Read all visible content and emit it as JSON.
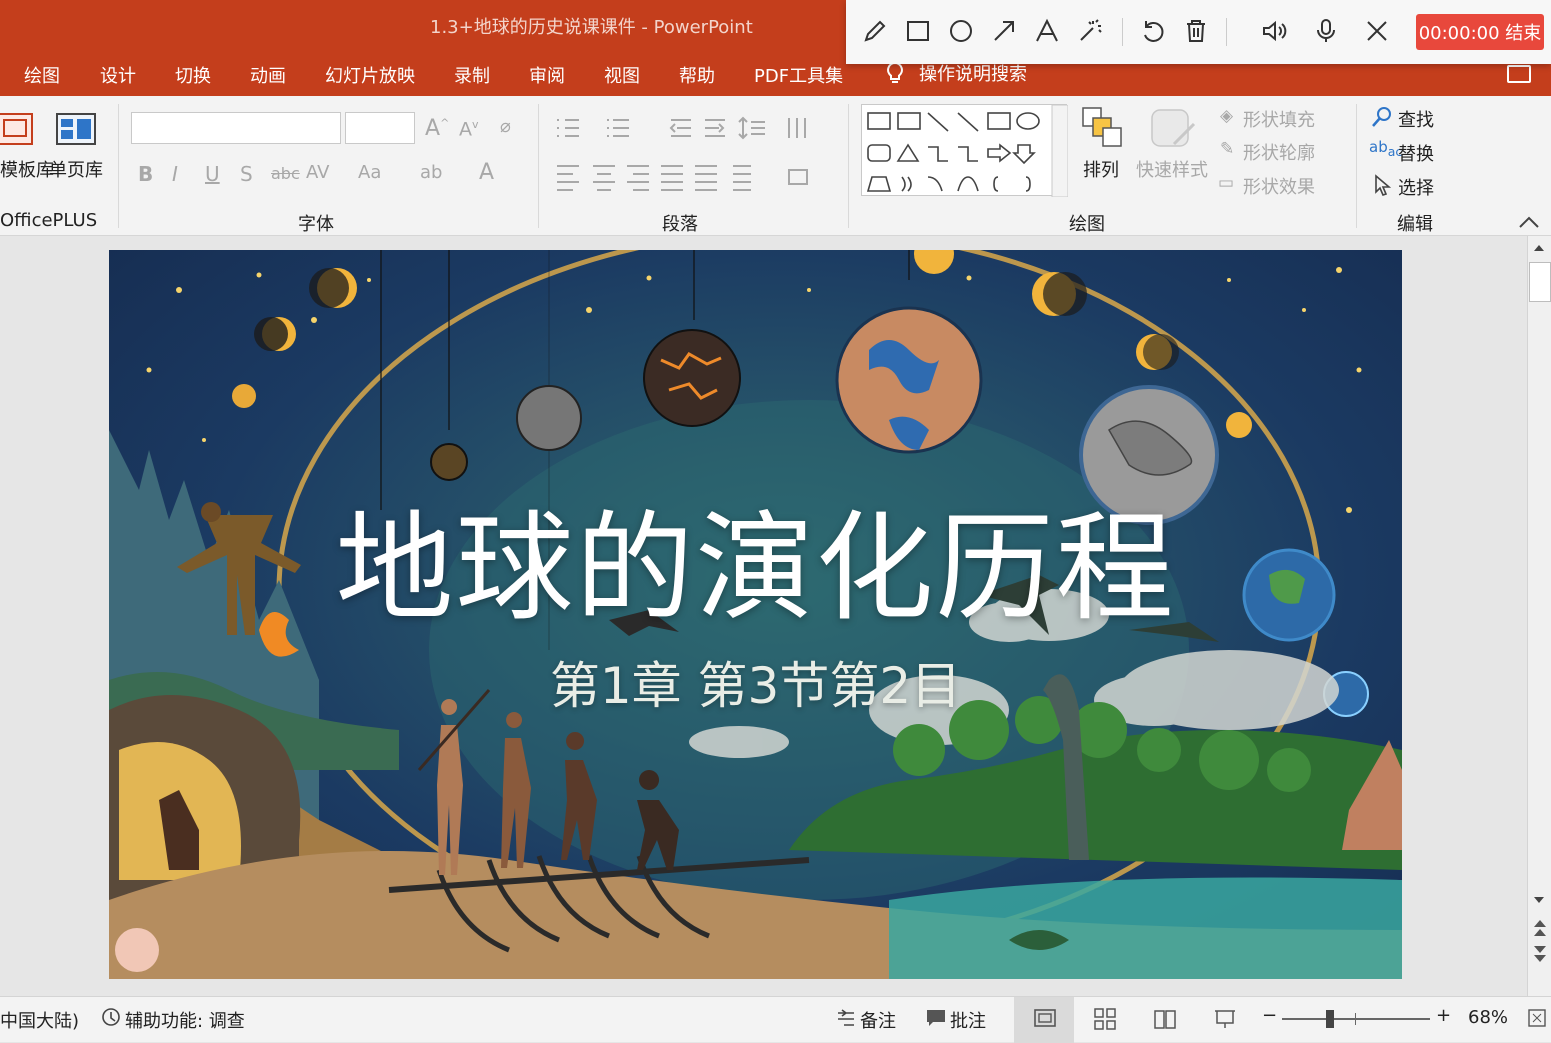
{
  "window": {
    "title": "1.3+地球的历史说课课件  -  PowerPoint"
  },
  "tabs": [
    "绘图",
    "设计",
    "切换",
    "动画",
    "幻灯片放映",
    "录制",
    "审阅",
    "视图",
    "帮助",
    "PDF工具集"
  ],
  "tell_me": "操作说明搜索",
  "draw_toolbar": {
    "tools": [
      "pencil-icon",
      "rectangle-icon",
      "circle-icon",
      "arrow-icon",
      "text-icon",
      "laser-pointer-icon",
      "undo-icon",
      "trash-icon",
      "speaker-icon",
      "microphone-icon",
      "close-icon"
    ],
    "recording": "00:00:00 结束"
  },
  "ribbon": {
    "officeplus": {
      "template_lib": "模板库",
      "single_page_lib": "单页库",
      "group": "OfficePLUS"
    },
    "font": {
      "group": "字体",
      "buttons": [
        "B",
        "I",
        "U",
        "S",
        "abc",
        "AV",
        "Aa",
        "A"
      ]
    },
    "paragraph": {
      "group": "段落"
    },
    "drawing": {
      "group": "绘图",
      "arrange": "排列",
      "quick_styles": "快速样式",
      "shape_fill": "形状填充",
      "shape_outline": "形状轮廓",
      "shape_effects": "形状效果"
    },
    "editing": {
      "group": "编辑",
      "find": "查找",
      "replace": "替换",
      "select": "选择"
    }
  },
  "slide": {
    "title": "地球的演化历程",
    "subtitle": "第1章 第3节第2目"
  },
  "status": {
    "language": "中国大陆)",
    "accessibility": "辅助功能: 调查",
    "notes": "备注",
    "comments": "批注",
    "zoom": "68%",
    "zoom_level": 0.68
  },
  "colors": {
    "accent": "#c43e1c",
    "record": "#e8483c"
  }
}
